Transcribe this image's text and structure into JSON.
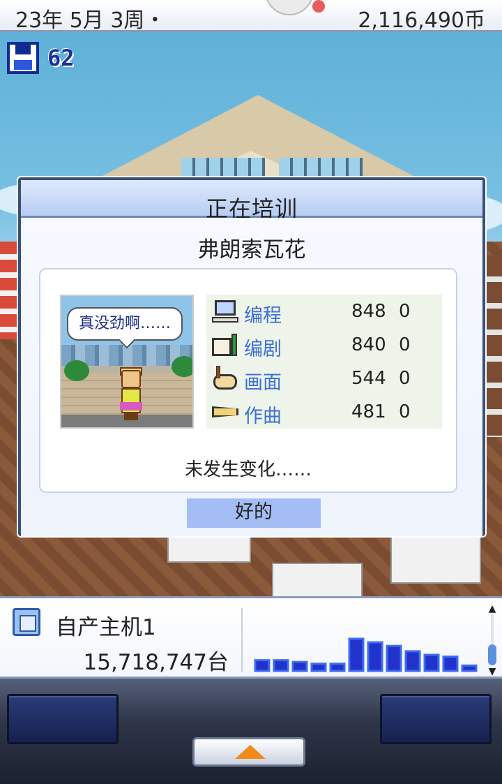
{
  "status": {
    "date": "23年 5月 3周・",
    "money": "2,116,490币"
  },
  "save": {
    "count": "62"
  },
  "dialog": {
    "title": "正在培训",
    "staff_name": "弗朗索瓦花",
    "speech": "真没劲啊……",
    "stats": [
      {
        "label": "编程",
        "value": "848",
        "delta": "0",
        "icon": "computer-icon"
      },
      {
        "label": "编剧",
        "value": "840",
        "delta": "0",
        "icon": "book-pen-icon"
      },
      {
        "label": "画面",
        "value": "544",
        "delta": "0",
        "icon": "palette-icon"
      },
      {
        "label": "作曲",
        "value": "481",
        "delta": "0",
        "icon": "trumpet-icon"
      }
    ],
    "result": "未发生变化……",
    "ok_label": "好的"
  },
  "console": {
    "name": "自产主机1",
    "sales": "15,718,747台",
    "sales_history": [
      3,
      3,
      2.5,
      2,
      2,
      9,
      8,
      7,
      5.5,
      4.5,
      4,
      1.5
    ],
    "bar_color": "#2233cc",
    "bar_highlight": "#3d6cf0"
  },
  "colors": {
    "accent": "#3b6fd6",
    "ok_button": "#a5bdf5",
    "dialog_border": "#38517a"
  }
}
